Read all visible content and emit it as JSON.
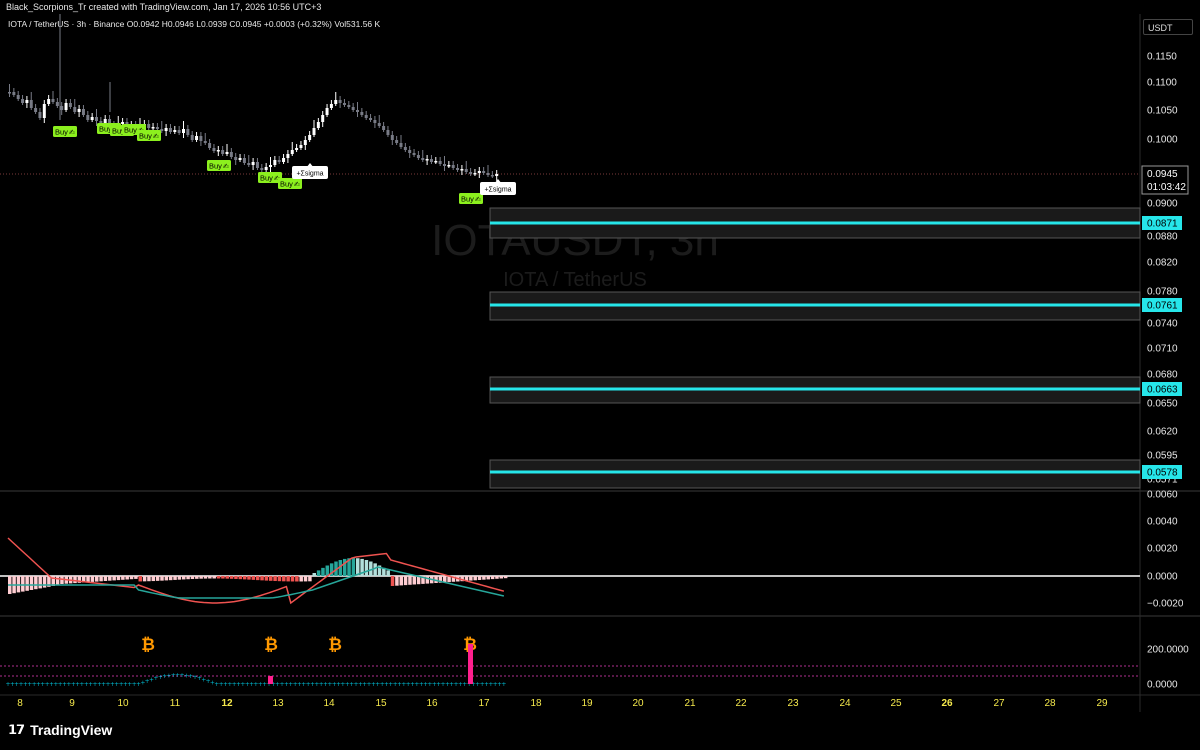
{
  "credit": "Black_Scorpions_Tr created with TradingView.com, Jan 17, 2026 10:56 UTC+3",
  "symbol_line": {
    "symbol": "IOTA / TetherUS · 3h · Binance",
    "open": "O0.0942",
    "high": "H0.0946",
    "low": "L0.0939",
    "close": "C0.0945",
    "change": "+0.0003 (+0.32%)",
    "volume": "Vol531.56 K"
  },
  "currency": "USDT",
  "watermark": {
    "main": "IOTAUSDT, 3h",
    "sub": "IOTA / TetherUS"
  },
  "price_axis": {
    "ticks": [
      "0.1150",
      "0.1100",
      "0.1050",
      "0.1000",
      "0.0900",
      "0.0880",
      "0.0820",
      "0.0780",
      "0.0740",
      "0.0710",
      "0.0680",
      "0.0650",
      "0.0620",
      "0.0595",
      "0.0571"
    ],
    "current_price": "0.0945",
    "countdown": "01:03:42",
    "level_labels": [
      "0.0871",
      "0.0761",
      "0.0663",
      "0.0578"
    ]
  },
  "macd_axis": {
    "ticks": [
      "0.0060",
      "0.0040",
      "0.0020",
      "0.0000",
      "−0.0020"
    ]
  },
  "third_axis": {
    "ticks": [
      "200.0000",
      "0.0000"
    ]
  },
  "time_axis": {
    "ticks": [
      "8",
      "9",
      "10",
      "11",
      "12",
      "13",
      "14",
      "15",
      "16",
      "17",
      "18",
      "19",
      "20",
      "21",
      "22",
      "23",
      "24",
      "25",
      "26",
      "27",
      "28",
      "29"
    ]
  },
  "signals": {
    "buy_label": "Buy",
    "sigma_label": "+Σsigma",
    "bitcoin_symbol": "₿"
  },
  "colors": {
    "background": "#000000",
    "up_candle": "#ffffff",
    "down_candle": "#787b86",
    "level_line": "#26e6ea",
    "buy_bg": "#8cf01e",
    "macd_pos": "#26a69a",
    "macd_neg": "#ef5350",
    "signal_line": "#ef5350",
    "bitcoin": "#ff9800",
    "spike": "#ff1f8e",
    "dots": "#00bcd4",
    "axis_text": "#f5e94c"
  },
  "footer": {
    "brand": "TradingView"
  }
}
